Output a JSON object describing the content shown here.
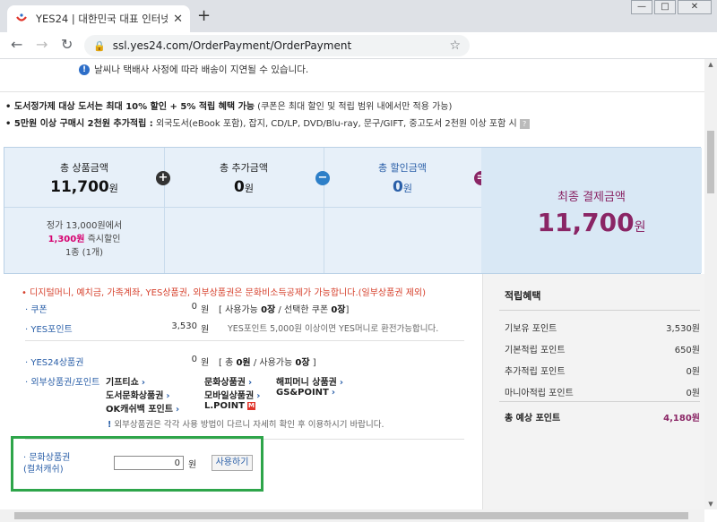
{
  "browser": {
    "tab_title": "YES24 | 대한민국 대표 인터넷서",
    "tab_close": "✕",
    "new_tab": "+",
    "url": "ssl.yes24.com/OrderPayment/OrderPayment",
    "back_glyph": "←",
    "forward_glyph": "→",
    "reload_glyph": "↻",
    "lock_glyph": "🔒",
    "star_glyph": "☆",
    "win_min": "—",
    "win_max": "□",
    "win_close": "✕"
  },
  "notice": {
    "icon": "!",
    "text": "날씨나 택배사 사정에 따라 배송이 지연될 수 있습니다."
  },
  "benefits": {
    "line1_bold": "• 도서정가제 대상 도서는 최대 10% 할인 + 5% 적립 혜택 가능",
    "line1_rest": " (쿠폰은 최대 할인 및 적립 범위 내에서만 적용 가능)",
    "line2_bold": "• 5만원 이상 구매시 2천원 추가적립 :",
    "line2_rest": " 외국도서(eBook 포함), 잡지, CD/LP, DVD/Blu-ray, 문구/GIFT, 중고도서 2천원 이상 포함 시",
    "help_icon": "?"
  },
  "summary": {
    "product_label": "총 상품금액",
    "product_value": "11,700",
    "extra_label": "총 추가금액",
    "extra_value": "0",
    "discount_label": "총 할인금액",
    "discount_value": "0",
    "unit": "원",
    "op_plus": "+",
    "op_minus": "−",
    "op_equal": "=",
    "detail_line1": "정가 13,000원에서",
    "detail_red": "1,300원",
    "detail_line2_rest": " 즉시할인",
    "detail_line3": "1종 (1개)",
    "final_label": "최종 결제금액",
    "final_value": "11,700",
    "accent_color": "#8a2565",
    "discount_label_color": "#2a5fa8"
  },
  "payment": {
    "warning": "• 디지털머니, 예치금, 가족계좌, YES상품권, 외부상품권은 문화비소득공제가 가능합니다.(일부상품권 제외)",
    "coupon_label": "· 쿠폰",
    "coupon_amount": "0",
    "coupon_unit": "원",
    "coupon_desc_a": "[ 사용가능 ",
    "coupon_desc_b": "0장",
    "coupon_desc_c": " / 선택한 쿠폰 ",
    "coupon_desc_d": "0장",
    "coupon_desc_e": "]",
    "yespoint_label": "· YES포인트",
    "yespoint_amount": "3,530",
    "yespoint_unit": "원",
    "yespoint_desc": "YES포인트 5,000원 이상이면 YES머니로 환전가능합니다.",
    "giftcard_label": "· YES24상품권",
    "giftcard_amount": "0",
    "giftcard_unit": "원",
    "giftcard_desc_a": "[ 총 ",
    "giftcard_desc_b": "0원",
    "giftcard_desc_c": " / 사용가능 ",
    "giftcard_desc_d": "0장",
    "giftcard_desc_e": " ]",
    "external_label": "· 외부상품권/포인트",
    "gifts": {
      "g1": "기프티쇼",
      "g2": "문화상품권",
      "g3": "해피머니 상품권",
      "g4": "도서문화상품권",
      "g5": "모바일상품권",
      "g6": "GS&POINT",
      "g7": "OK캐쉬백 포인트",
      "g8": "L.POINT"
    },
    "arrow": "›",
    "lpoint_badge": "M",
    "external_note_icon": "!",
    "external_note": " 외부상품권은 각각 사용 방법이 다르니 자세히 확인 후 이용하시기 바랍니다.",
    "culture_label_1": "· 문화상품권",
    "culture_label_2": "(컬처캐쉬)",
    "culture_value": "0",
    "culture_unit": "원",
    "use_button": "사용하기"
  },
  "points": {
    "title": "적립혜택",
    "rows": [
      {
        "label": "기보유 포인트",
        "value": "3,530원"
      },
      {
        "label": "기본적립 포인트",
        "value": "650원"
      },
      {
        "label": "추가적립 포인트",
        "value": "0원"
      },
      {
        "label": "마니아적립 포인트",
        "value": "0원"
      }
    ],
    "total_label": "총 예상 포인트",
    "total_value": "4,180원"
  }
}
